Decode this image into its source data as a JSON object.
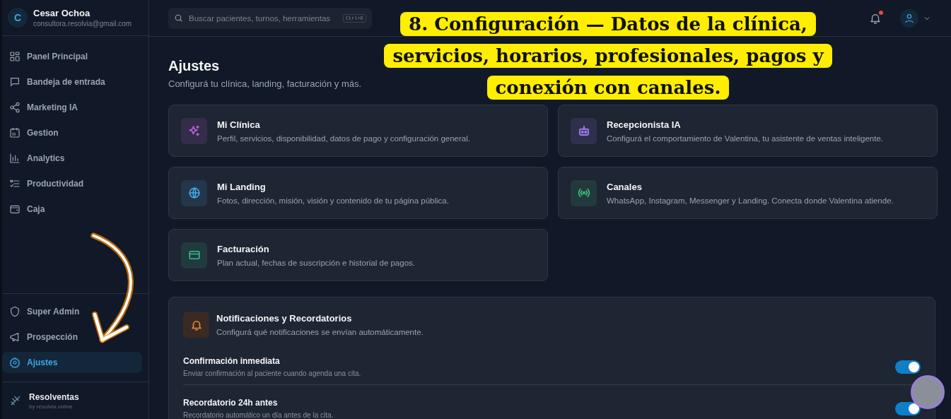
{
  "user": {
    "initial": "C",
    "name": "Cesar Ochoa",
    "email": "consultora.resolvia@gmail.com"
  },
  "nav": [
    {
      "label": "Panel Principal",
      "selected": false
    },
    {
      "label": "Bandeja de entrada",
      "selected": false
    },
    {
      "label": "Marketing IA",
      "selected": false
    },
    {
      "label": "Gestion",
      "selected": false
    },
    {
      "label": "Analytics",
      "selected": false
    },
    {
      "label": "Productividad",
      "selected": false
    },
    {
      "label": "Caja",
      "selected": false
    }
  ],
  "nav_bottom": [
    {
      "label": "Super Admin",
      "selected": false
    },
    {
      "label": "Prospección",
      "selected": false
    },
    {
      "label": "Ajustes",
      "selected": true
    }
  ],
  "brand": {
    "name": "Resolventas",
    "byline": "by resolvia.online"
  },
  "search": {
    "placeholder": "Buscar pacientes, turnos, herramientas",
    "shortcut": "Ctrl+K"
  },
  "notifications_unread": true,
  "page": {
    "title": "Ajustes",
    "subtitle": "Configurá tu clínica, landing, facturación y más."
  },
  "cards": [
    {
      "color": "#c061e0",
      "title": "Mi Clínica",
      "description": "Perfil, servicios, disponibilidad, datos de pago y configuración general."
    },
    {
      "color": "#9d7cf0",
      "title": "Recepcionista IA",
      "description": "Configurá el comportamiento de Valentina, tu asistente de ventas inteligente."
    },
    {
      "color": "#4aa8e8",
      "title": "Mi Landing",
      "description": "Fotos, dirección, misión, visión y contenido de tu página pública."
    },
    {
      "color": "#3ec47a",
      "title": "Canales",
      "description": "WhatsApp, Instagram, Messenger y Landing. Conecta donde Valentina atiende."
    },
    {
      "color": "#34c08a",
      "title": "Facturación",
      "description": "Plan actual, fechas de suscripción e historial de pagos."
    }
  ],
  "notifications": {
    "title": "Notificaciones y Recordatorios",
    "subtitle": "Configurá qué notificaciones se envían automáticamente.",
    "items": [
      {
        "label": "Confirmación inmediata",
        "description": "Enviar confirmación al paciente cuando agenda una cita.",
        "on": true
      },
      {
        "label": "Recordatorio 24h antes",
        "description": "Recordatorio automático un día antes de la cita.",
        "on": true
      }
    ]
  },
  "callout": "8. Configuración — Datos de la clínica, servicios, horarios, profesionales, pagos y conexión con canales."
}
